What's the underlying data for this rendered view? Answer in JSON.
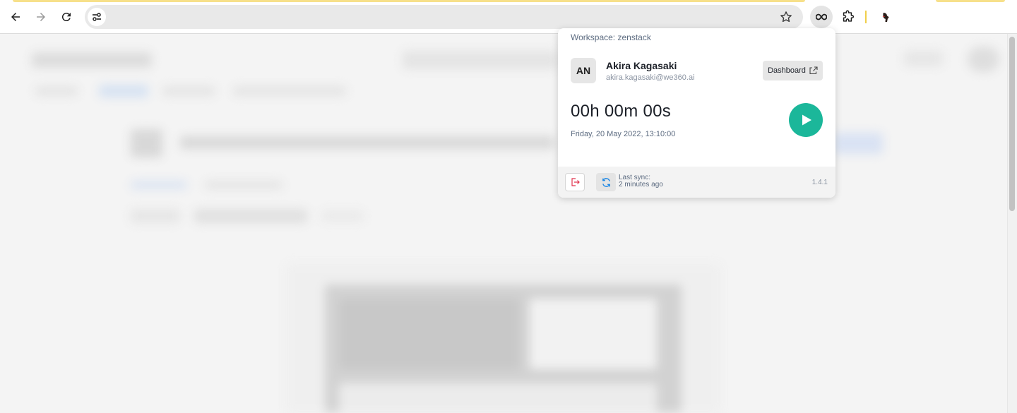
{
  "browser": {
    "icons": {
      "back": "arrow-left-icon",
      "forward": "arrow-right-icon",
      "reload": "reload-icon",
      "site_info": "tune-icon",
      "bookmark": "star-icon",
      "extension": "infinity-icon",
      "extensions_menu": "puzzle-icon",
      "profile": "profile-icon"
    },
    "address": ""
  },
  "popup": {
    "workspace": "Workspace: zenstack",
    "user": {
      "initials": "AN",
      "name": "Akira Kagasaki",
      "email": "akira.kagasaki@we360.ai"
    },
    "dashboard_label": "Dashboard",
    "timer": "00h 00m 00s",
    "datetime": "Friday, 20 May 2022, 13:10:00",
    "footer": {
      "sync_line1": "Last sync:",
      "sync_line2": "2 minutes ago",
      "version": "1.4.1"
    },
    "colors": {
      "play": "#1bb79a",
      "logout": "#e0334d",
      "sync": "#1e88e5"
    }
  }
}
